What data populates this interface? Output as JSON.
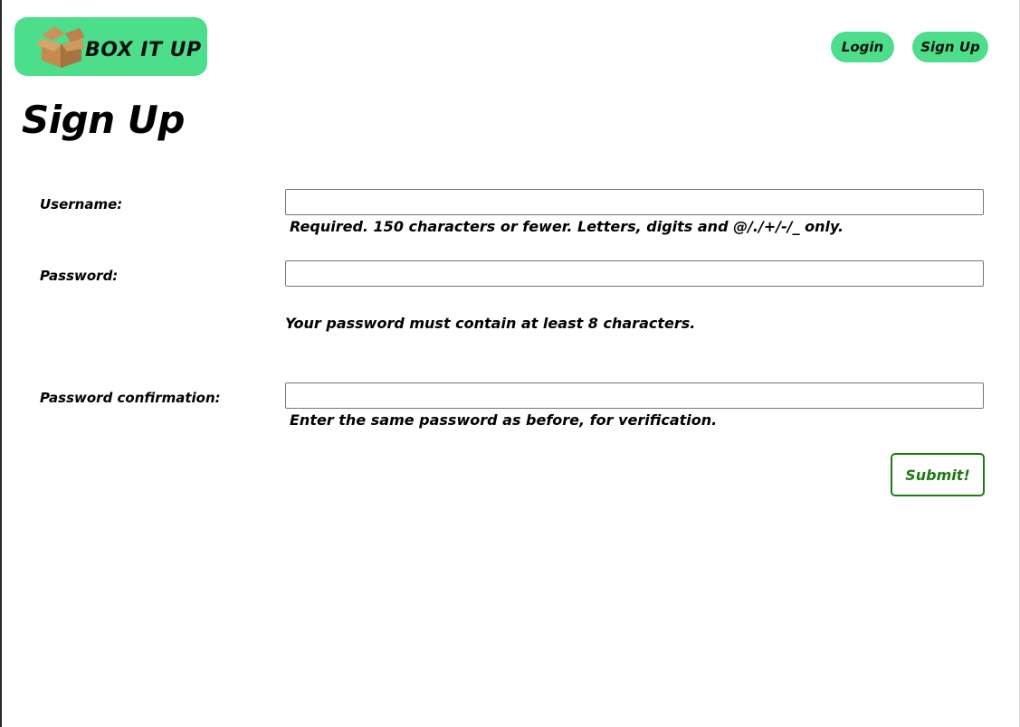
{
  "colors": {
    "accent": "#4dde8b",
    "submit": "#1e7a14"
  },
  "brand": {
    "logo_icon": "cardboard-box-icon",
    "name": "BOX IT UP"
  },
  "nav": {
    "login_label": "Login",
    "signup_label": "Sign Up"
  },
  "page": {
    "title": "Sign Up"
  },
  "form": {
    "username": {
      "label": "Username:",
      "value": "",
      "help": "Required. 150 characters or fewer. Letters, digits and @/./+/-/_ only."
    },
    "password": {
      "label": "Password:",
      "value": "",
      "help": "Your password must contain at least 8 characters."
    },
    "password_confirmation": {
      "label": "Password confirmation:",
      "value": "",
      "help": "Enter the same password as before, for verification."
    },
    "submit_label": "Submit!"
  }
}
